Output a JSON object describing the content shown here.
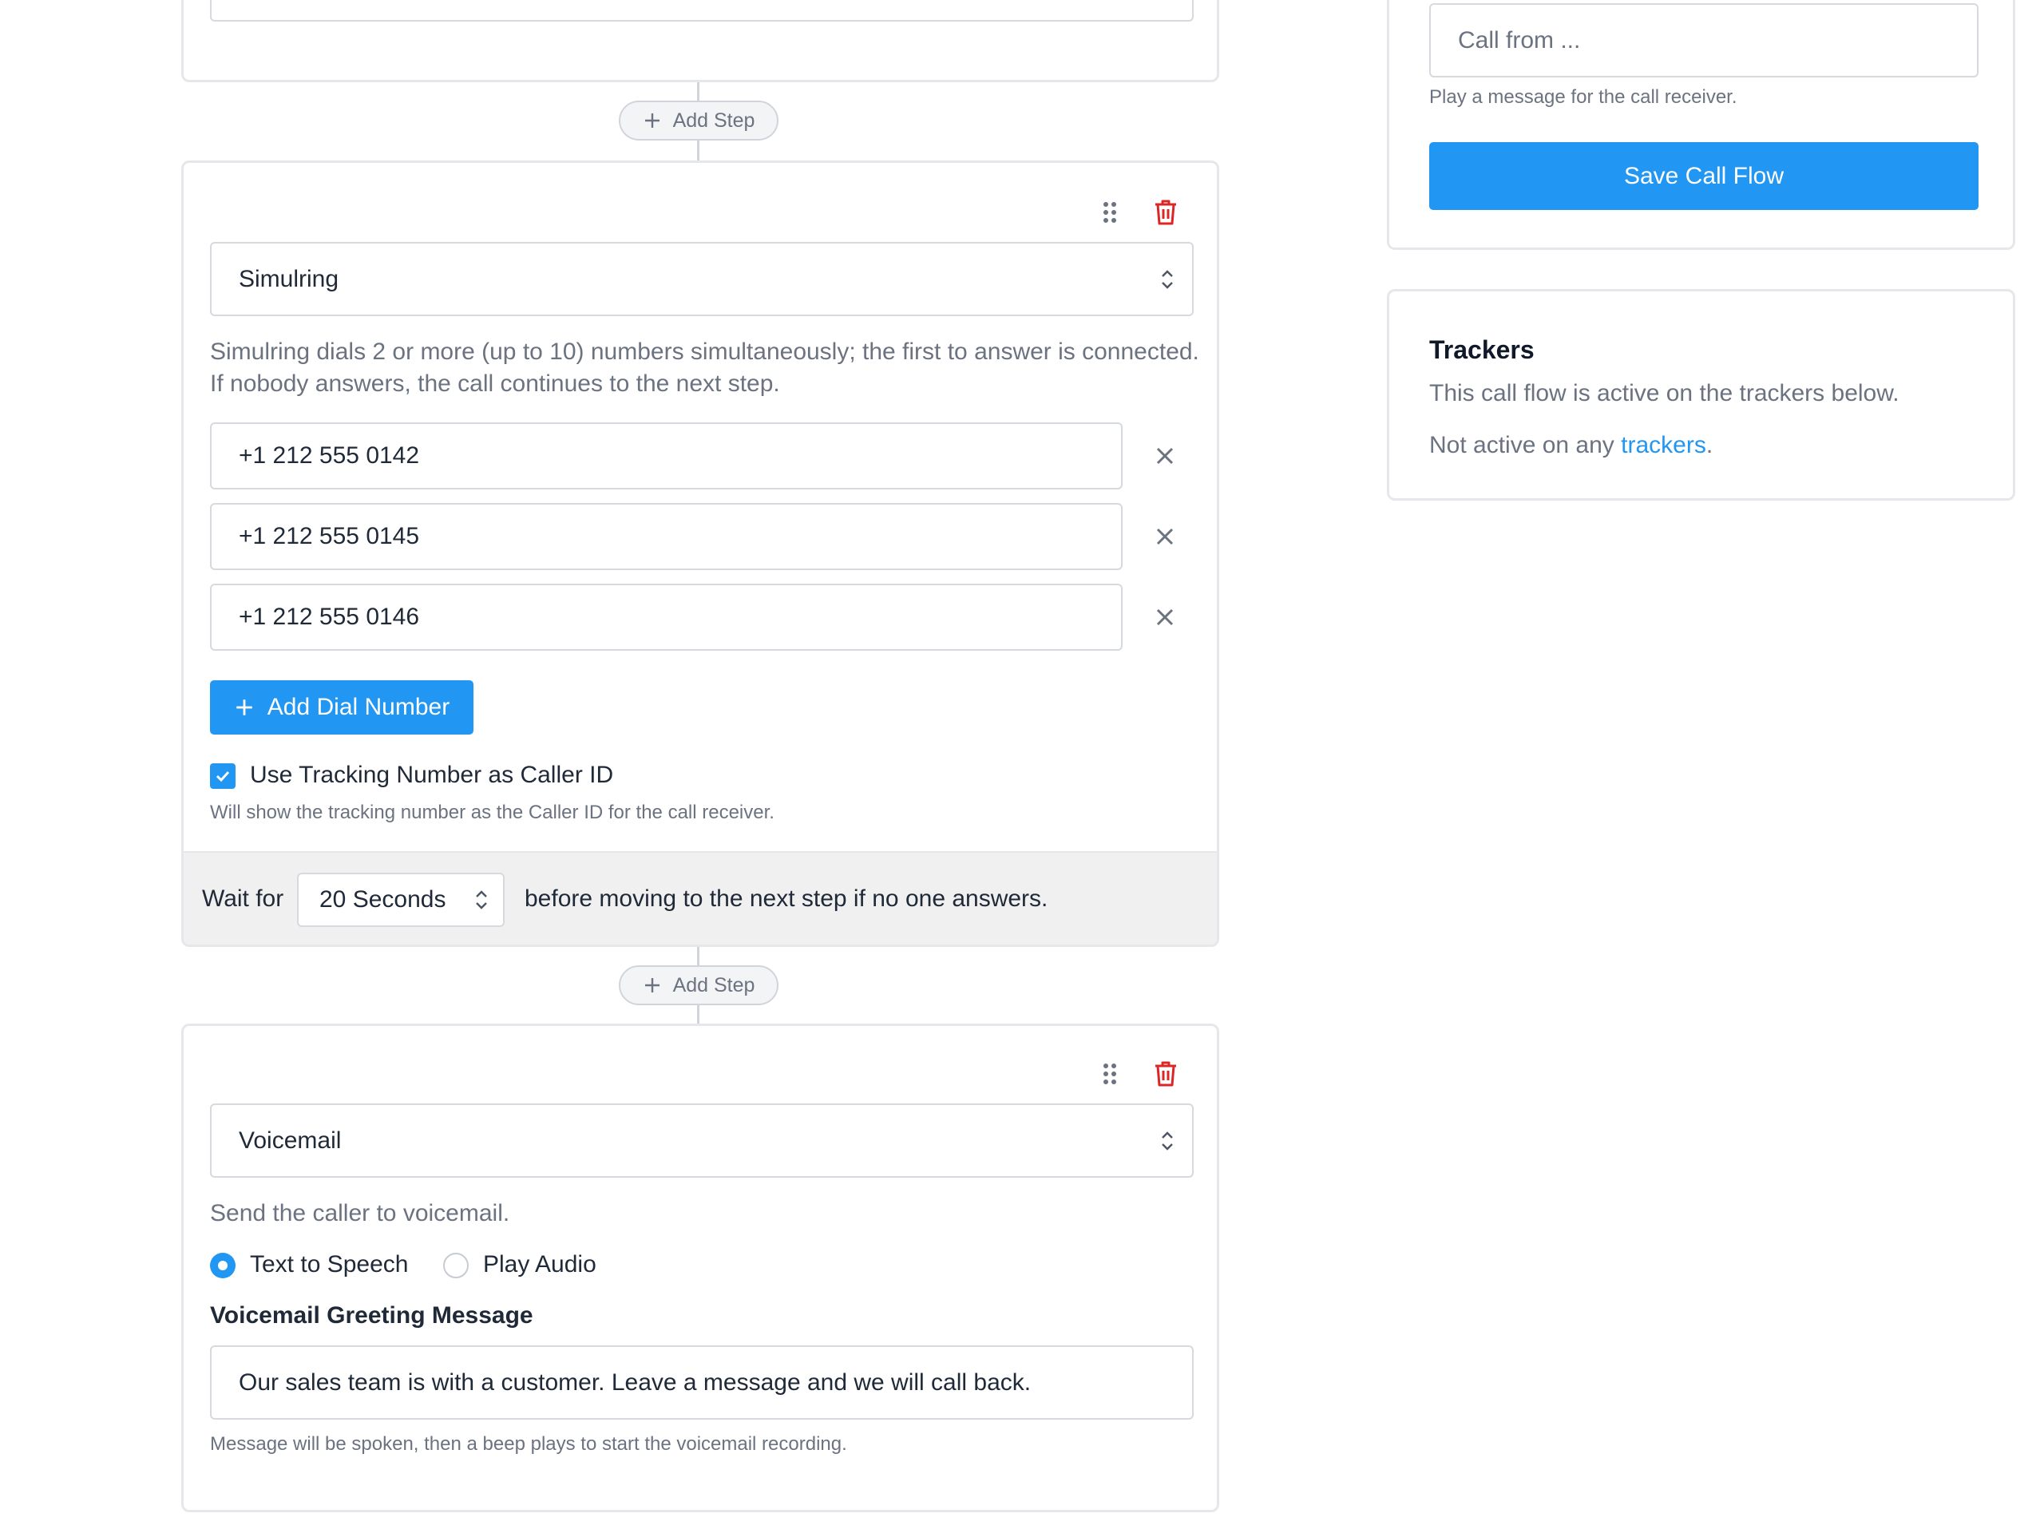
{
  "top_step": {},
  "add_step_label": "Add Step",
  "simulring": {
    "type_value": "Simulring",
    "description_line1": "Simulring dials 2 or more (up to 10) numbers simultaneously; the first to answer is connected.",
    "description_line2": "If nobody answers, the call continues to the next step.",
    "numbers": [
      "+1 212 555 0142",
      "+1 212 555 0145",
      "+1 212 555 0146"
    ],
    "add_number_label": "Add Dial Number",
    "caller_id_label": "Use Tracking Number as Caller ID",
    "caller_id_checked": true,
    "caller_id_help": "Will show the tracking number as the Caller ID for the call receiver.",
    "wait_prefix": "Wait for",
    "wait_value": "20 Seconds",
    "wait_suffix": "before moving to the next step if no one answers."
  },
  "voicemail": {
    "type_value": "Voicemail",
    "description": "Send the caller to voicemail.",
    "radio_tts": "Text to Speech",
    "radio_audio": "Play Audio",
    "selected_mode": "Text to Speech",
    "greeting_label": "Voicemail Greeting Message",
    "greeting_value": "Our sales team is with a customer. Leave a message and we will call back.",
    "greeting_help": "Message will be spoken, then a beep plays to start the voicemail recording."
  },
  "sidebar": {
    "call_from_placeholder": "Call from ...",
    "call_from_help": "Play a message for the call receiver.",
    "save_label": "Save Call Flow",
    "trackers_title": "Trackers",
    "trackers_desc": "This call flow is active on the trackers below.",
    "not_active_prefix": "Not active on any ",
    "trackers_link": "trackers",
    "not_active_suffix": "."
  },
  "colors": {
    "primary": "#2196f3",
    "danger": "#dc2626",
    "link": "#2196f3"
  }
}
